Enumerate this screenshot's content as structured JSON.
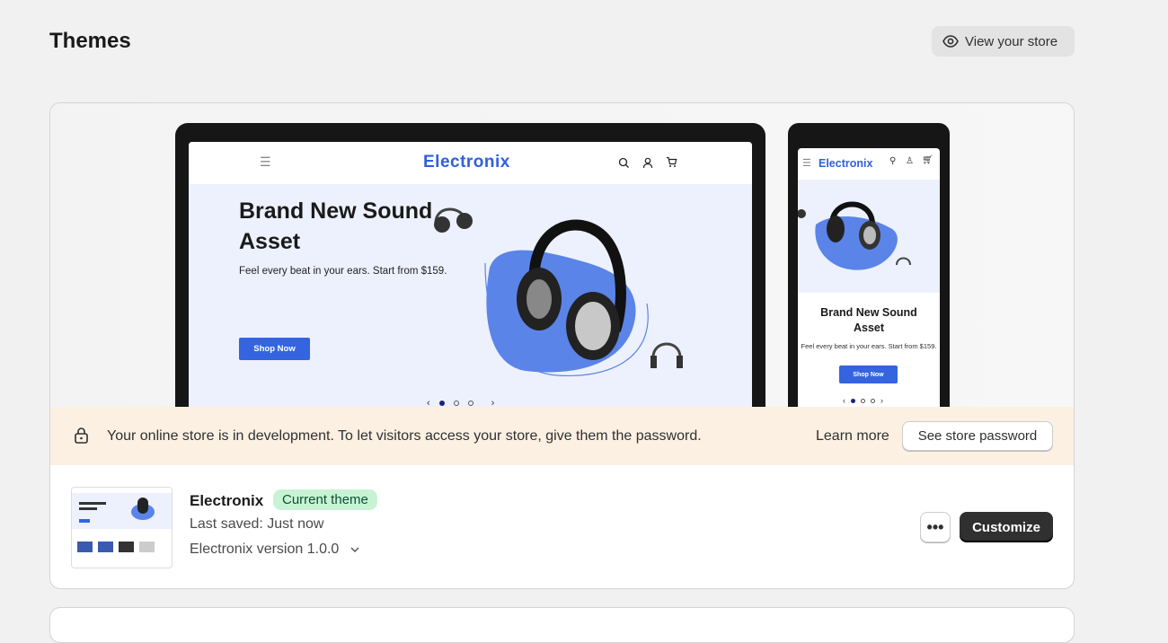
{
  "header": {
    "title": "Themes",
    "view_store_label": "View your store",
    "view_store_icon": "eye-icon"
  },
  "preview": {
    "store_logo": "Electronix",
    "hero_title": "Brand New Sound Asset",
    "hero_text": "Feel every beat in your ears. Start from $159.",
    "hero_button": "Shop Now",
    "slide_current": 1,
    "slide_count": 3,
    "accent_color": "#3464e0"
  },
  "banner": {
    "icon": "lock-icon",
    "message": "Your online store is in development. To let visitors access your store, give them the password.",
    "learn_more": "Learn more",
    "password_button": "See store password",
    "background": "#fcf0e3"
  },
  "theme": {
    "name": "Electronix",
    "badge": "Current theme",
    "last_saved": "Last saved: Just now",
    "version": "Electronix version 1.0.0",
    "more_label": "•••",
    "customize_label": "Customize"
  }
}
